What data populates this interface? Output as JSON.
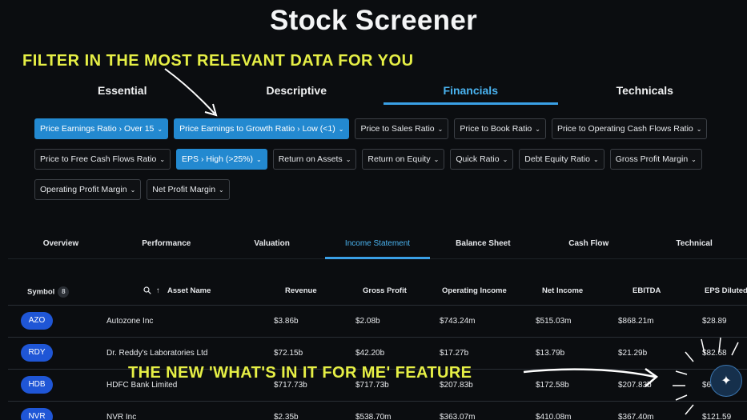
{
  "page": {
    "title": "Stock Screener"
  },
  "captions": {
    "top": "FILTER IN THE MOST RELEVANT DATA FOR YOU",
    "bottom": "THE NEW 'WHAT'S IN IT FOR ME' FEATURE"
  },
  "category_tabs": [
    {
      "label": "Essential",
      "active": false
    },
    {
      "label": "Descriptive",
      "active": false
    },
    {
      "label": "Financials",
      "active": true
    },
    {
      "label": "Technicals",
      "active": false
    }
  ],
  "filters": [
    [
      {
        "label": "Price Earnings Ratio › Over 15",
        "active": true
      },
      {
        "label": "Price Earnings to Growth Ratio › Low (<1)",
        "active": true
      },
      {
        "label": "Price to Sales Ratio",
        "active": false
      },
      {
        "label": "Price to Book Ratio",
        "active": false
      },
      {
        "label": "Price to Operating Cash Flows Ratio",
        "active": false
      }
    ],
    [
      {
        "label": "Price to Free Cash Flows Ratio",
        "active": false
      },
      {
        "label": "EPS › High (>25%)",
        "active": true
      },
      {
        "label": "Return on Assets",
        "active": false
      },
      {
        "label": "Return on Equity",
        "active": false
      },
      {
        "label": "Quick Ratio",
        "active": false
      },
      {
        "label": "Debt Equity Ratio",
        "active": false
      },
      {
        "label": "Gross Profit Margin",
        "active": false
      }
    ],
    [
      {
        "label": "Operating Profit Margin",
        "active": false
      },
      {
        "label": "Net Profit Margin",
        "active": false
      }
    ]
  ],
  "view_tabs": [
    {
      "label": "Overview",
      "active": false
    },
    {
      "label": "Performance",
      "active": false
    },
    {
      "label": "Valuation",
      "active": false
    },
    {
      "label": "Income Statement",
      "active": true
    },
    {
      "label": "Balance Sheet",
      "active": false
    },
    {
      "label": "Cash Flow",
      "active": false
    },
    {
      "label": "Technical",
      "active": false
    }
  ],
  "table": {
    "symbol_header": "Symbol",
    "symbol_count": "8",
    "asset_header": "Asset Name",
    "columns": [
      "Revenue",
      "Gross Profit",
      "Operating Income",
      "Net Income",
      "EBITDA",
      "EPS Diluted"
    ],
    "rows": [
      {
        "symbol": "AZO",
        "name": "Autozone Inc",
        "values": [
          "$3.86b",
          "$2.08b",
          "$743.24m",
          "$515.03m",
          "$868.21m",
          "$28.89"
        ]
      },
      {
        "symbol": "RDY",
        "name": "Dr. Reddy's Laboratories Ltd",
        "values": [
          "$72.15b",
          "$42.20b",
          "$17.27b",
          "$13.79b",
          "$21.29b",
          "$82.68"
        ]
      },
      {
        "symbol": "HDB",
        "name": "HDFC Bank Limited",
        "values": [
          "$717.73b",
          "$717.73b",
          "$207.83b",
          "$172.58b",
          "$207.83b",
          "$6"
        ]
      },
      {
        "symbol": "NVR",
        "name": "NVR Inc",
        "values": [
          "$2.35b",
          "$538.70m",
          "$363.07m",
          "$410.08m",
          "$367.40m",
          "$121.59"
        ]
      }
    ]
  },
  "icons": {
    "search": "search-icon",
    "sort": "sort-up-arrow-icon",
    "ai": "sparkle-icon"
  },
  "colors": {
    "accent": "#3aa0e6",
    "chip_active": "#2389d0",
    "symbol_badge": "#1f56d6",
    "caption": "#e6ef45"
  }
}
